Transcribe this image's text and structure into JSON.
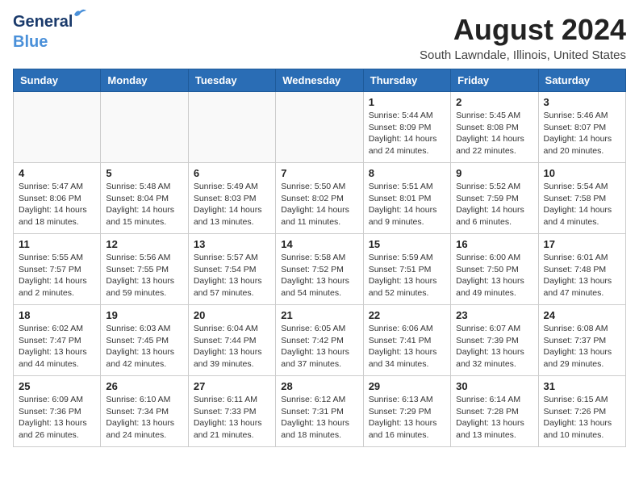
{
  "header": {
    "logo_line1": "General",
    "logo_line2": "Blue",
    "month_year": "August 2024",
    "location": "South Lawndale, Illinois, United States"
  },
  "days_of_week": [
    "Sunday",
    "Monday",
    "Tuesday",
    "Wednesday",
    "Thursday",
    "Friday",
    "Saturday"
  ],
  "weeks": [
    [
      {
        "day": "",
        "info": ""
      },
      {
        "day": "",
        "info": ""
      },
      {
        "day": "",
        "info": ""
      },
      {
        "day": "",
        "info": ""
      },
      {
        "day": "1",
        "info": "Sunrise: 5:44 AM\nSunset: 8:09 PM\nDaylight: 14 hours\nand 24 minutes."
      },
      {
        "day": "2",
        "info": "Sunrise: 5:45 AM\nSunset: 8:08 PM\nDaylight: 14 hours\nand 22 minutes."
      },
      {
        "day": "3",
        "info": "Sunrise: 5:46 AM\nSunset: 8:07 PM\nDaylight: 14 hours\nand 20 minutes."
      }
    ],
    [
      {
        "day": "4",
        "info": "Sunrise: 5:47 AM\nSunset: 8:06 PM\nDaylight: 14 hours\nand 18 minutes."
      },
      {
        "day": "5",
        "info": "Sunrise: 5:48 AM\nSunset: 8:04 PM\nDaylight: 14 hours\nand 15 minutes."
      },
      {
        "day": "6",
        "info": "Sunrise: 5:49 AM\nSunset: 8:03 PM\nDaylight: 14 hours\nand 13 minutes."
      },
      {
        "day": "7",
        "info": "Sunrise: 5:50 AM\nSunset: 8:02 PM\nDaylight: 14 hours\nand 11 minutes."
      },
      {
        "day": "8",
        "info": "Sunrise: 5:51 AM\nSunset: 8:01 PM\nDaylight: 14 hours\nand 9 minutes."
      },
      {
        "day": "9",
        "info": "Sunrise: 5:52 AM\nSunset: 7:59 PM\nDaylight: 14 hours\nand 6 minutes."
      },
      {
        "day": "10",
        "info": "Sunrise: 5:54 AM\nSunset: 7:58 PM\nDaylight: 14 hours\nand 4 minutes."
      }
    ],
    [
      {
        "day": "11",
        "info": "Sunrise: 5:55 AM\nSunset: 7:57 PM\nDaylight: 14 hours\nand 2 minutes."
      },
      {
        "day": "12",
        "info": "Sunrise: 5:56 AM\nSunset: 7:55 PM\nDaylight: 13 hours\nand 59 minutes."
      },
      {
        "day": "13",
        "info": "Sunrise: 5:57 AM\nSunset: 7:54 PM\nDaylight: 13 hours\nand 57 minutes."
      },
      {
        "day": "14",
        "info": "Sunrise: 5:58 AM\nSunset: 7:52 PM\nDaylight: 13 hours\nand 54 minutes."
      },
      {
        "day": "15",
        "info": "Sunrise: 5:59 AM\nSunset: 7:51 PM\nDaylight: 13 hours\nand 52 minutes."
      },
      {
        "day": "16",
        "info": "Sunrise: 6:00 AM\nSunset: 7:50 PM\nDaylight: 13 hours\nand 49 minutes."
      },
      {
        "day": "17",
        "info": "Sunrise: 6:01 AM\nSunset: 7:48 PM\nDaylight: 13 hours\nand 47 minutes."
      }
    ],
    [
      {
        "day": "18",
        "info": "Sunrise: 6:02 AM\nSunset: 7:47 PM\nDaylight: 13 hours\nand 44 minutes."
      },
      {
        "day": "19",
        "info": "Sunrise: 6:03 AM\nSunset: 7:45 PM\nDaylight: 13 hours\nand 42 minutes."
      },
      {
        "day": "20",
        "info": "Sunrise: 6:04 AM\nSunset: 7:44 PM\nDaylight: 13 hours\nand 39 minutes."
      },
      {
        "day": "21",
        "info": "Sunrise: 6:05 AM\nSunset: 7:42 PM\nDaylight: 13 hours\nand 37 minutes."
      },
      {
        "day": "22",
        "info": "Sunrise: 6:06 AM\nSunset: 7:41 PM\nDaylight: 13 hours\nand 34 minutes."
      },
      {
        "day": "23",
        "info": "Sunrise: 6:07 AM\nSunset: 7:39 PM\nDaylight: 13 hours\nand 32 minutes."
      },
      {
        "day": "24",
        "info": "Sunrise: 6:08 AM\nSunset: 7:37 PM\nDaylight: 13 hours\nand 29 minutes."
      }
    ],
    [
      {
        "day": "25",
        "info": "Sunrise: 6:09 AM\nSunset: 7:36 PM\nDaylight: 13 hours\nand 26 minutes."
      },
      {
        "day": "26",
        "info": "Sunrise: 6:10 AM\nSunset: 7:34 PM\nDaylight: 13 hours\nand 24 minutes."
      },
      {
        "day": "27",
        "info": "Sunrise: 6:11 AM\nSunset: 7:33 PM\nDaylight: 13 hours\nand 21 minutes."
      },
      {
        "day": "28",
        "info": "Sunrise: 6:12 AM\nSunset: 7:31 PM\nDaylight: 13 hours\nand 18 minutes."
      },
      {
        "day": "29",
        "info": "Sunrise: 6:13 AM\nSunset: 7:29 PM\nDaylight: 13 hours\nand 16 minutes."
      },
      {
        "day": "30",
        "info": "Sunrise: 6:14 AM\nSunset: 7:28 PM\nDaylight: 13 hours\nand 13 minutes."
      },
      {
        "day": "31",
        "info": "Sunrise: 6:15 AM\nSunset: 7:26 PM\nDaylight: 13 hours\nand 10 minutes."
      }
    ]
  ]
}
